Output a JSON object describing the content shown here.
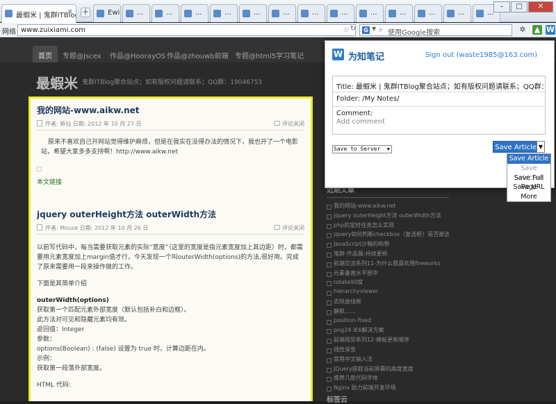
{
  "browser": {
    "tabs": [
      {
        "label": "最蝦米 | 鬼群ITBlog聚..."
      },
      {
        "label": "Ewi..."
      },
      {
        "label": "..."
      },
      {
        "label": "..."
      },
      {
        "label": "..."
      },
      {
        "label": "..."
      },
      {
        "label": "..."
      },
      {
        "label": "..."
      },
      {
        "label": "..."
      },
      {
        "label": "..."
      },
      {
        "label": "..."
      },
      {
        "label": "..."
      },
      {
        "label": "..."
      },
      {
        "label": "..."
      },
      {
        "label": "..."
      }
    ],
    "new_tab": "+",
    "nav_label": "网络",
    "url": "www.zuixiami.com",
    "search_placeholder": "使用Google搜索",
    "search_engine_icon": "G"
  },
  "site": {
    "nav": [
      "首页",
      "专题@Jscex",
      "作品@HoorayOS",
      "作品@zhouwb前端",
      "专题@html5学习笔记"
    ],
    "title": "最蝦米",
    "description": "鬼群ITBlog聚合站点；如有版权问题请联系；QQ群：19046753"
  },
  "posts": [
    {
      "title": "我的网站-www.aikw.net",
      "meta": "作者: 新仙 日期: 2012 年 10 月 27 日",
      "comment": "评论关闭",
      "body": "原来不喜欢自己开网站觉得维护麻烦，但是在我实在没得办法的情况下，我也开了一个电影站，希望大家多多支持啊！http://www.aikw.net",
      "more": "本文链接"
    },
    {
      "title": "jquery outerHeight方法 outerWidth方法",
      "meta": "作者: Mouse 日期: 2012 年 10 月 26 日",
      "comment": "评论关闭",
      "intro": "以前写代码中，每当需要获取元素的实际“宽度”（这里的宽度是指元素宽度加上其边距）时，都需要用元素宽度加上margin值才行，今天发现一个叫outerWidth(options)的方法,很好用。完成了原来需要用一段来操作做的工作。",
      "subhead": "下面是其简单介绍",
      "method": "outerWidth(options)",
      "lines": [
        "获取第一个匹配元素外部宽度（默认包括补白和边框）。",
        "此方法对可见和隐藏元素均有效。",
        "返回值：Integer",
        "参数：",
        "options(Boolean) : (false) 设置为 true 时，计算边距在内。",
        "示例：",
        "获取第一段落外部宽度。"
      ],
      "code_label": "HTML 代码:"
    }
  ],
  "sidebar": {
    "title": "近期文章",
    "items": [
      "我的网站-www.aikw.net",
      "jquery outerHeight方法 outerWidth方法",
      "php的定时任务怎么实现",
      "jquery如何判断checkbox（复选框）是否被选中",
      "JavaScript沙箱的构想",
      "鬼群-作品展-持续更新",
      "前端交流系列11-为什么我喜欢用fireworks",
      "元素垂直水平居中",
      "rotate90度",
      "hierarchyviewer",
      "去除虚线框",
      "静默……",
      "position-fixed",
      "png24 IE6解决方案",
      "前端视觉系列12-模板更新顺序",
      "线性渐变",
      "禁用中文输入法",
      "JQuery获取当前屏幕的高度宽度",
      "推荐几款代码字体",
      "Nginx 助力前端开发环境"
    ],
    "next_section": "标签云"
  },
  "clipper": {
    "brand": "为知笔记",
    "logo_letter": "W",
    "signout": "Sign out (waste1985@163.com)",
    "title_field": "Title: 最蝦米 | 鬼群ITBlog聚合站点；如有版权问题请联系；QQ群：19046753",
    "folder_field": "Folder: /My Notes/",
    "comment_label": "Comment:",
    "comment_placeholder": "Add comment",
    "action_select": "Save to Server",
    "save_button": "Save Article",
    "menu": [
      {
        "label": "Save Article",
        "state": "selected"
      },
      {
        "label": "Save Selected",
        "state": "disabled"
      },
      {
        "label": "Save Full Page",
        "state": "normal"
      },
      {
        "label": "Save URL",
        "state": "normal"
      },
      {
        "label": "More",
        "state": "normal"
      }
    ],
    "accent": "#2f73c3"
  }
}
